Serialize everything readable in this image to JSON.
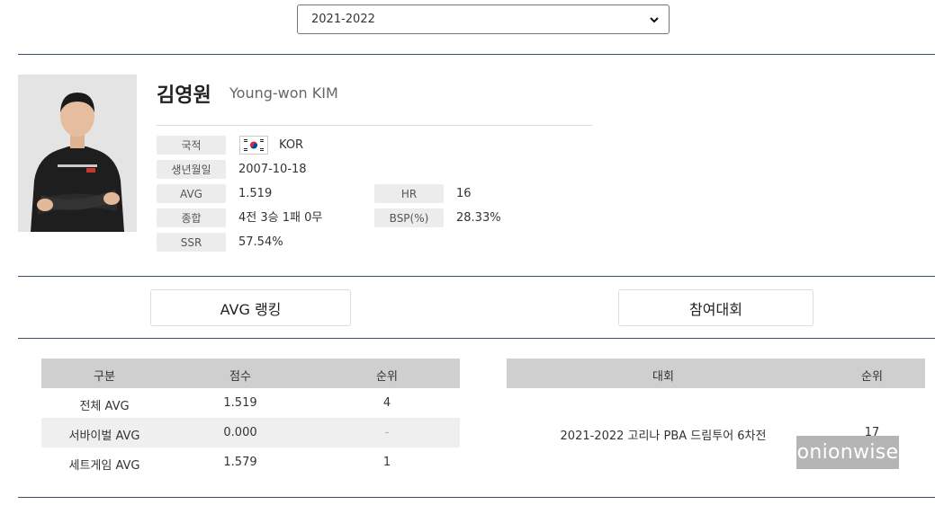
{
  "season_selector": {
    "value": "2021-2022"
  },
  "player": {
    "name_ko": "김영원",
    "name_en": "Young-won KIM"
  },
  "info": {
    "nationality_label": "국적",
    "nationality_value": "KOR",
    "birth_label": "생년월일",
    "birth_value": "2007-10-18",
    "avg_label": "AVG",
    "avg_value": "1.519",
    "hr_label": "HR",
    "hr_value": "16",
    "record_label": "종합",
    "record_value": "4전 3승 1패 0무",
    "bsp_label": "BSP(%)",
    "bsp_value": "28.33%",
    "ssr_label": "SSR",
    "ssr_value": "57.54%"
  },
  "tabs": {
    "avg_ranking": "AVG 랭킹",
    "tournaments": "참여대회"
  },
  "avg_table": {
    "headers": [
      "구분",
      "점수",
      "순위"
    ],
    "rows": [
      [
        "전체 AVG",
        "1.519",
        "4"
      ],
      [
        "서바이벌 AVG",
        "0.000",
        "-"
      ],
      [
        "세트게임 AVG",
        "1.579",
        "1"
      ]
    ]
  },
  "tournament_table": {
    "headers": [
      "대회",
      "순위"
    ],
    "rows": [
      [
        "2021-2022 고리나 PBA 드림투어 6차전",
        "17"
      ]
    ]
  },
  "watermark": "onionwise",
  "colors": {
    "rule": "#3c5068",
    "header_bg": "#cfcfcf",
    "label_bg": "#ececec",
    "stripe_bg": "#efefef"
  }
}
